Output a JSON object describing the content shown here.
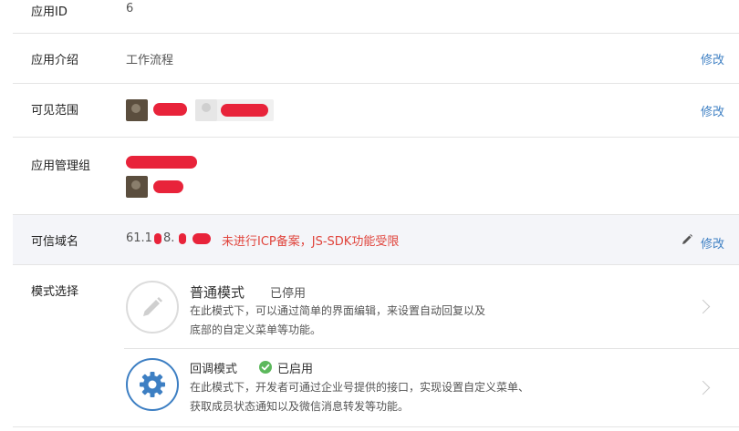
{
  "app_id": {
    "label": "应用ID",
    "value": "6"
  },
  "intro": {
    "label": "应用介绍",
    "value": "工作流程",
    "edit": "修改"
  },
  "visibility": {
    "label": "可见范围",
    "edit": "修改"
  },
  "admin_group": {
    "label": "应用管理组"
  },
  "trusted_domain": {
    "label": "可信域名",
    "value": "61.1",
    "value_mid": "8.",
    "warning": "未进行ICP备案，JS-SDK功能受限",
    "edit": "修改"
  },
  "mode": {
    "label": "模式选择",
    "normal": {
      "title": "普通模式",
      "status": "已停用",
      "desc_line1": "在此模式下，可以通过简单的界面编辑，来设置自动回复以及",
      "desc_line2": "底部的自定义菜单等功能。"
    },
    "callback": {
      "title": "回调模式",
      "status": "已启用",
      "desc_line1": "在此模式下，开发者可通过企业号提供的接口，实现设置自定义菜单、",
      "desc_line2": "获取成员状态通知以及微信消息转发等功能。"
    }
  },
  "colors": {
    "link": "#3d7fc3",
    "warning": "#e0443c",
    "enabled": "#5cb85c",
    "highlight_bg": "#f4f5f9",
    "redaction": "#e8233a"
  }
}
